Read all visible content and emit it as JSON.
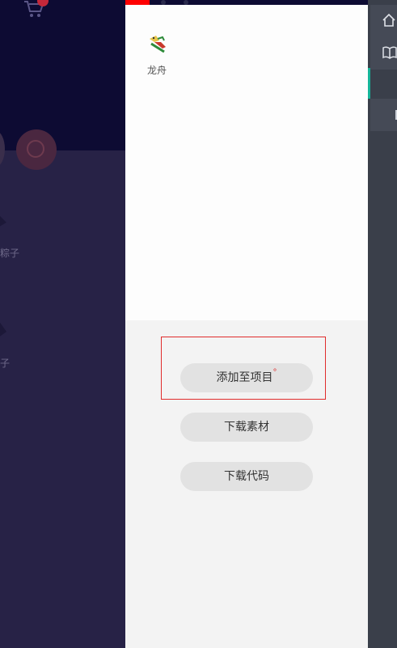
{
  "panel": {
    "item": {
      "label": "龙舟",
      "icon": "dragon-boat-icon"
    },
    "buttons": {
      "add_to_project": "添加至项目",
      "add_mark": "°",
      "download_asset": "下载素材",
      "download_code": "下载代码"
    }
  },
  "background": {
    "labels": [
      "粽子",
      "子"
    ]
  },
  "sidebar": {
    "icons": [
      "home-icon",
      "book-icon"
    ]
  },
  "colors": {
    "accent": "#15b59a",
    "highlight": "#e02c2c",
    "panel": "#f3f3f3",
    "background": "#272246"
  }
}
